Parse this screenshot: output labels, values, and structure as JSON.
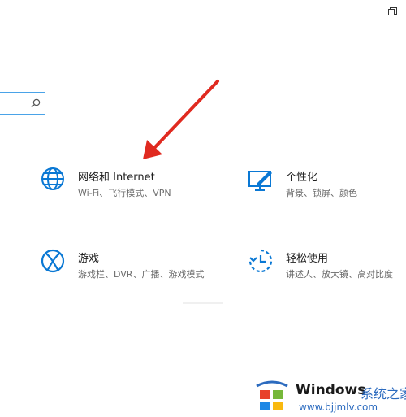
{
  "tiles": [
    {
      "title": "网络和 Internet",
      "desc": "Wi-Fi、飞行模式、VPN",
      "icon": "globe-icon"
    },
    {
      "title": "个性化",
      "desc": "背景、锁屏、颜色",
      "icon": "personalization-icon"
    },
    {
      "title": "游戏",
      "desc": "游戏栏、DVR、广播、游戏模式",
      "icon": "xbox-icon"
    },
    {
      "title": "轻松使用",
      "desc": "讲述人、放大镜、高对比度",
      "icon": "ease-of-access-icon"
    }
  ],
  "watermark": {
    "brand": "Windows",
    "brand_cn": "系统之家",
    "url": "www.bjjmlv.com"
  },
  "colors": {
    "accent": "#0a78d4",
    "arrow": "#e02a20"
  }
}
